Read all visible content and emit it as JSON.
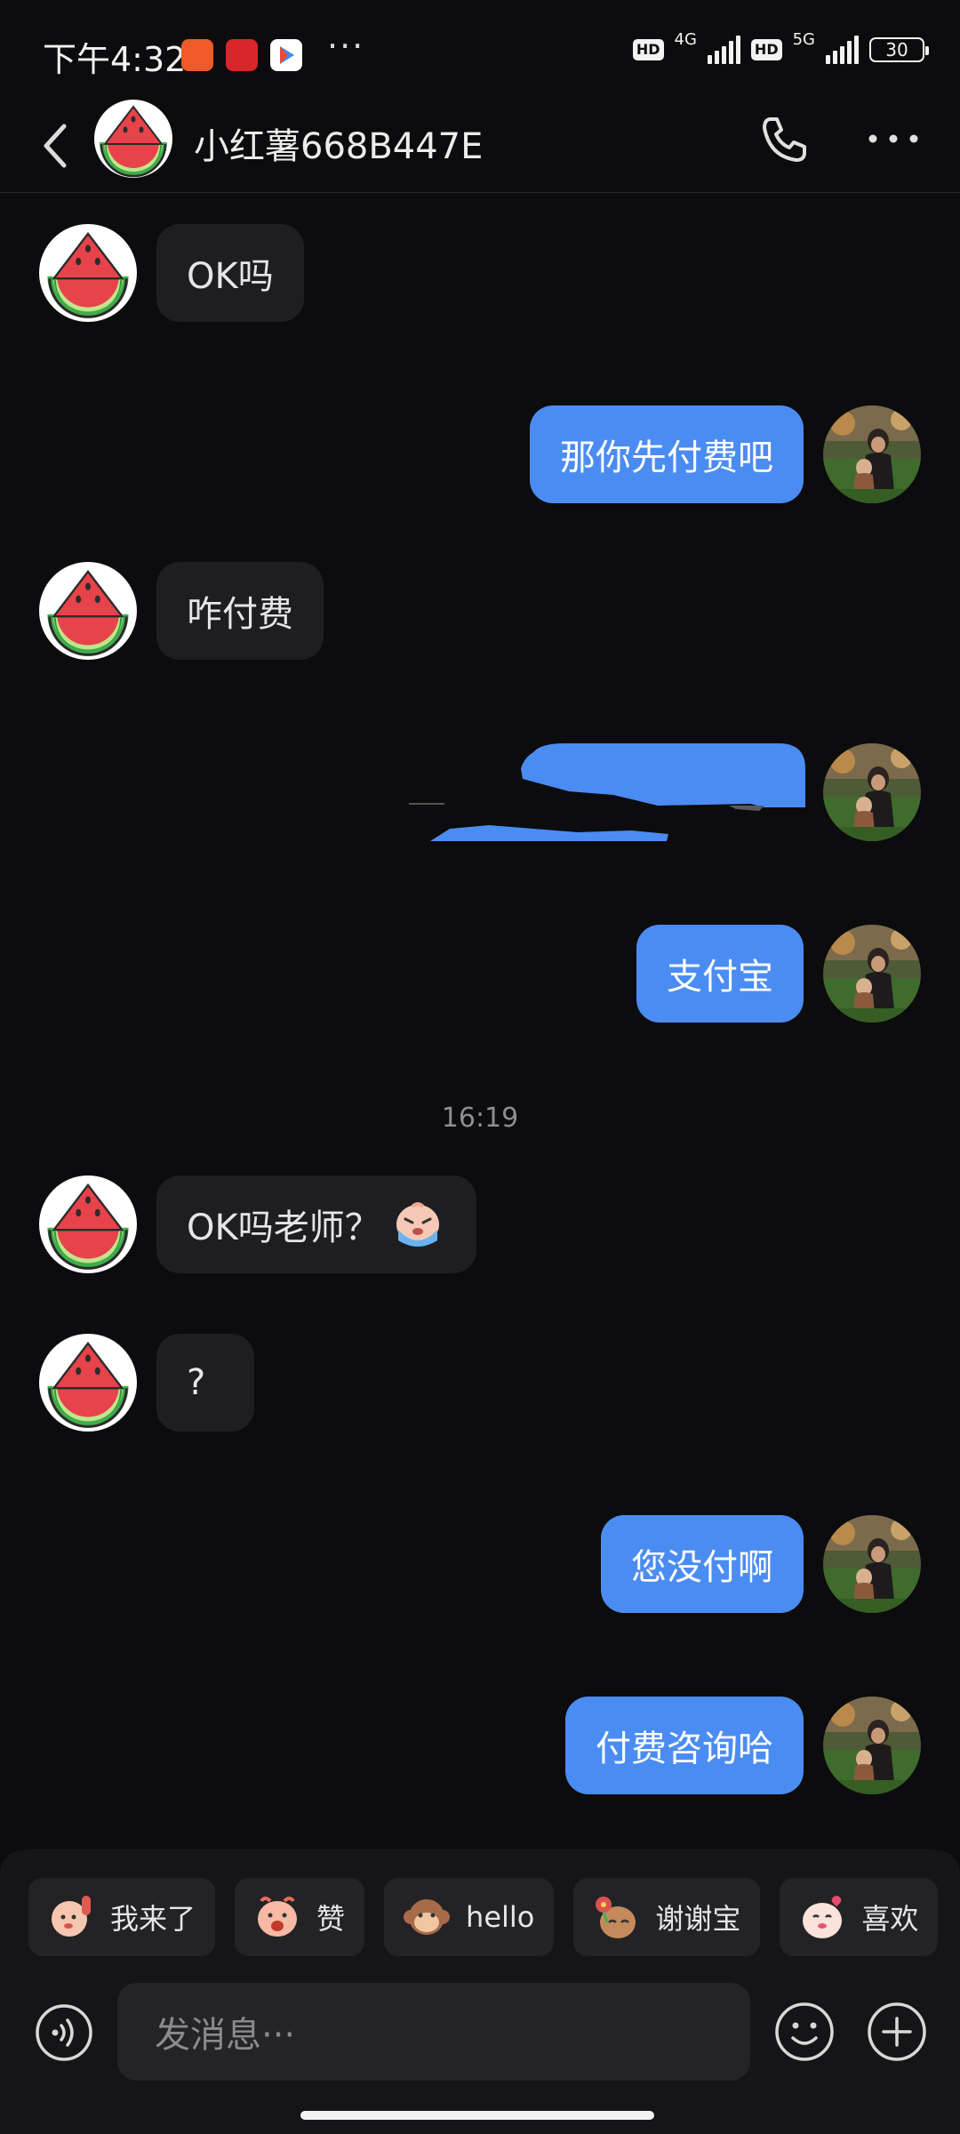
{
  "status_bar": {
    "time": "下午4:32",
    "dots": "···",
    "hd": "HD",
    "net1": "4G",
    "net2": "5G",
    "battery": "30"
  },
  "header": {
    "name": "小红薯668B447E"
  },
  "messages": {
    "m1": "OK吗",
    "m2": "那你先付费吧",
    "m3": "咋付费",
    "m5": "支付宝",
    "time": "16:19",
    "m6": "OK吗老师？",
    "m7": "?",
    "m8": "您没付啊",
    "m9": "付费咨询哈"
  },
  "quick_replies": [
    {
      "label": "我来了",
      "icon": "waving-emoji-icon"
    },
    {
      "label": "赞",
      "icon": "cheering-emoji-icon"
    },
    {
      "label": "hello",
      "icon": "monkey-emoji-icon"
    },
    {
      "label": "谢谢宝",
      "icon": "flower-emoji-icon"
    },
    {
      "label": "喜欢",
      "icon": "heart-emoji-icon"
    }
  ],
  "input": {
    "placeholder": "发消息···"
  },
  "colors": {
    "background": "#0c0c0e",
    "outgoing_bubble": "#4b8cf2",
    "incoming_bubble": "#1e1e21"
  }
}
